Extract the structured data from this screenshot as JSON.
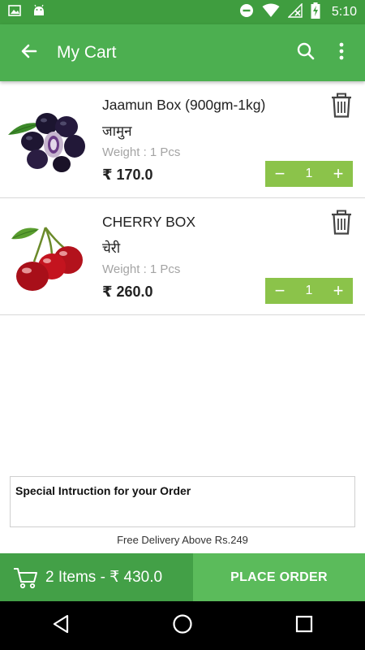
{
  "status_bar": {
    "time": "5:10",
    "left_icons": [
      "image-icon",
      "android-icon"
    ],
    "right_icons": [
      "dnd-icon",
      "wifi-icon",
      "no-signal-icon",
      "battery-charging-icon"
    ]
  },
  "app_bar": {
    "title": "My Cart",
    "back_icon": "arrow-left-icon",
    "actions": [
      "search-icon",
      "more-vert-icon"
    ]
  },
  "cart": {
    "items": [
      {
        "name": "Jaamun Box (900gm-1kg)",
        "name_hindi": "जामुन",
        "weight": "Weight : 1 Pcs",
        "price": "₹ 170.0",
        "quantity": "1",
        "image": "jamun-fruit"
      },
      {
        "name": "CHERRY BOX",
        "name_hindi": "चेरी",
        "weight": "Weight : 1 Pcs",
        "price": "₹ 260.0",
        "quantity": "1",
        "image": "cherry-fruit"
      }
    ],
    "minus_symbol": "−",
    "plus_symbol": "+"
  },
  "instructions": {
    "label": "Special Intruction for your Order"
  },
  "delivery_note": "Free Delivery Above Rs.249",
  "bottom_bar": {
    "summary": "2 Items - ₹ 430.0",
    "place_order": "PLACE ORDER"
  },
  "nav_bar": [
    "back-triangle-icon",
    "home-circle-icon",
    "recents-square-icon"
  ],
  "colors": {
    "status_bar": "#3f9d3f",
    "app_bar": "#4caf50",
    "stepper": "#8bc34a",
    "summary_bg": "#43a047",
    "place_order_bg": "#5bbb5b"
  }
}
